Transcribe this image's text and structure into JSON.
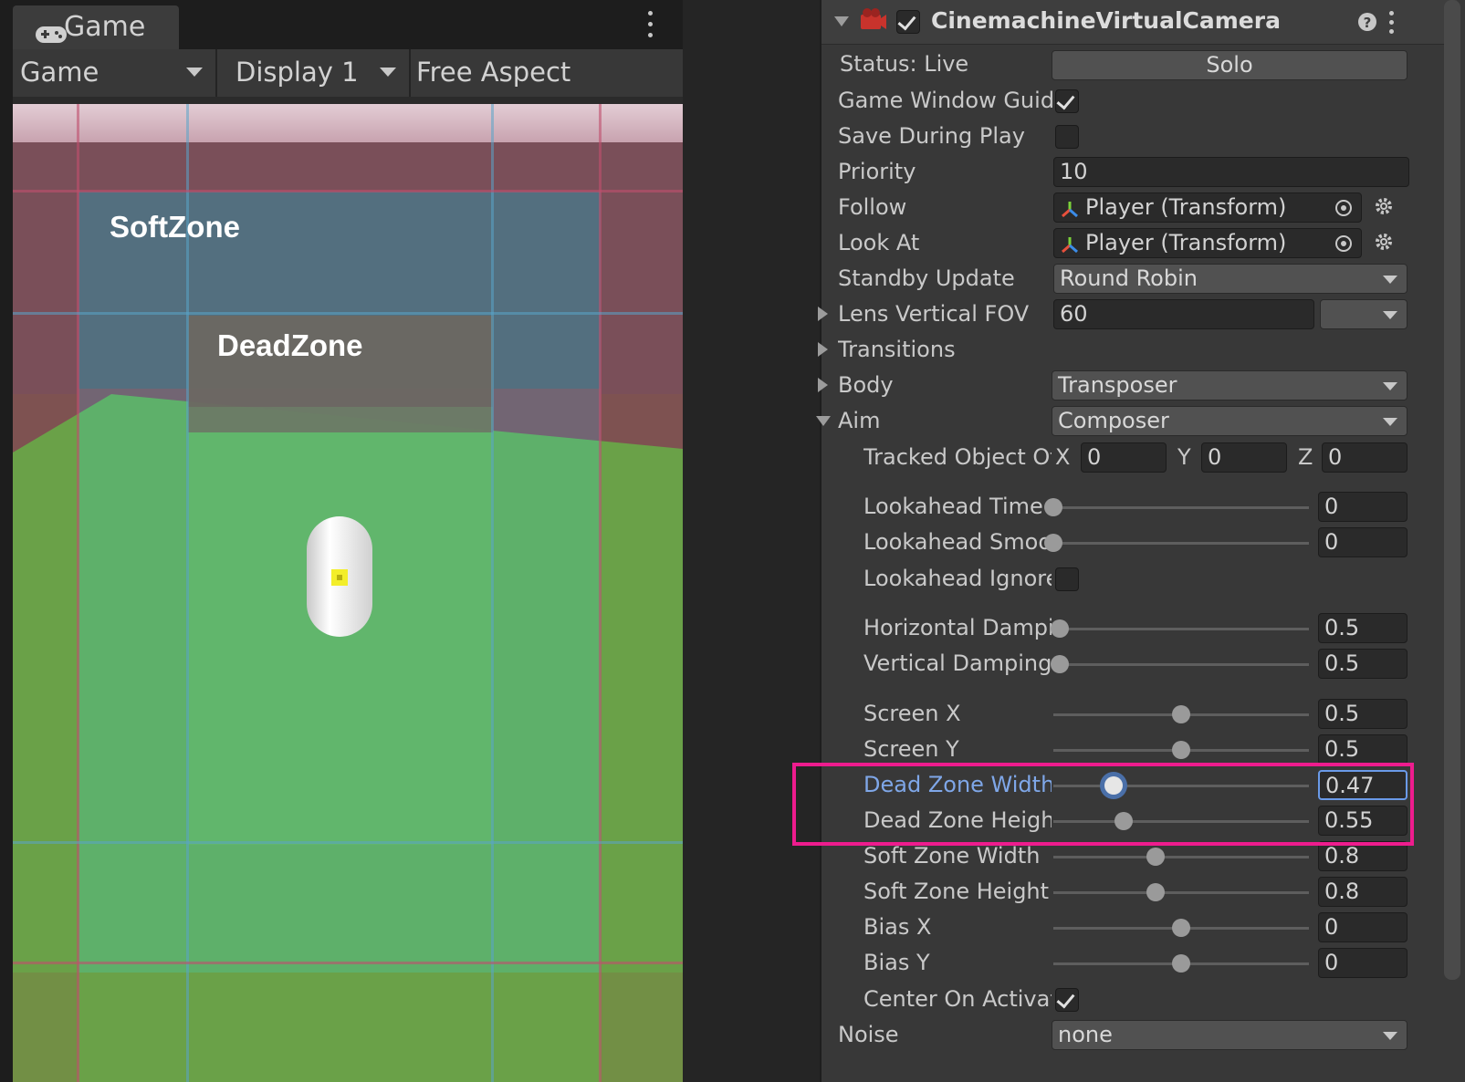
{
  "game": {
    "tab_label": "Game",
    "toolbar": {
      "mode": "Game",
      "display": "Display 1",
      "aspect": "Free Aspect"
    },
    "zones": {
      "soft_label": "SoftZone",
      "dead_label": "DeadZone"
    }
  },
  "inspector": {
    "component_title": "CinemachineVirtualCamera",
    "enabled": true,
    "status_label": "Status: Live",
    "solo_label": "Solo",
    "game_window_guides_label": "Game Window Guides",
    "game_window_guides": true,
    "save_during_play_label": "Save During Play",
    "save_during_play": false,
    "priority_label": "Priority",
    "priority": "10",
    "follow_label": "Follow",
    "follow": "Player (Transform)",
    "look_at_label": "Look At",
    "look_at": "Player (Transform)",
    "standby_update_label": "Standby Update",
    "standby_update": "Round Robin",
    "lens_fov_label": "Lens Vertical FOV",
    "lens_fov": "60",
    "transitions_label": "Transitions",
    "body_label": "Body",
    "body": "Transposer",
    "aim_label": "Aim",
    "aim": "Composer",
    "tracked_offset_label": "Tracked Object Offset",
    "tracked_offset": {
      "x_label": "X",
      "x": "0",
      "y_label": "Y",
      "y": "0",
      "z_label": "Z",
      "z": "0"
    },
    "lookahead_ignore_label": "Lookahead Ignore Y",
    "lookahead_ignore": false,
    "center_on_activate_label": "Center On Activate",
    "center_on_activate": true,
    "noise_label": "Noise",
    "noise": "none",
    "sliders": [
      {
        "label": "Lookahead Time",
        "value": "0",
        "fraction": 0.0
      },
      {
        "label": "Lookahead Smoothing",
        "value": "0",
        "fraction": 0.0
      },
      {
        "label": "Horizontal Damping",
        "value": "0.5",
        "fraction": 0.025
      },
      {
        "label": "Vertical Damping",
        "value": "0.5",
        "fraction": 0.025
      },
      {
        "label": "Screen X",
        "value": "0.5",
        "fraction": 0.5
      },
      {
        "label": "Screen Y",
        "value": "0.5",
        "fraction": 0.5
      },
      {
        "label": "Dead Zone Width",
        "value": "0.47",
        "fraction": 0.235,
        "active": true
      },
      {
        "label": "Dead Zone Height",
        "value": "0.55",
        "fraction": 0.275
      },
      {
        "label": "Soft Zone Width",
        "value": "0.8",
        "fraction": 0.4
      },
      {
        "label": "Soft Zone Height",
        "value": "0.8",
        "fraction": 0.4
      },
      {
        "label": "Bias X",
        "value": "0",
        "fraction": 0.5
      },
      {
        "label": "Bias Y",
        "value": "0",
        "fraction": 0.5
      }
    ]
  }
}
